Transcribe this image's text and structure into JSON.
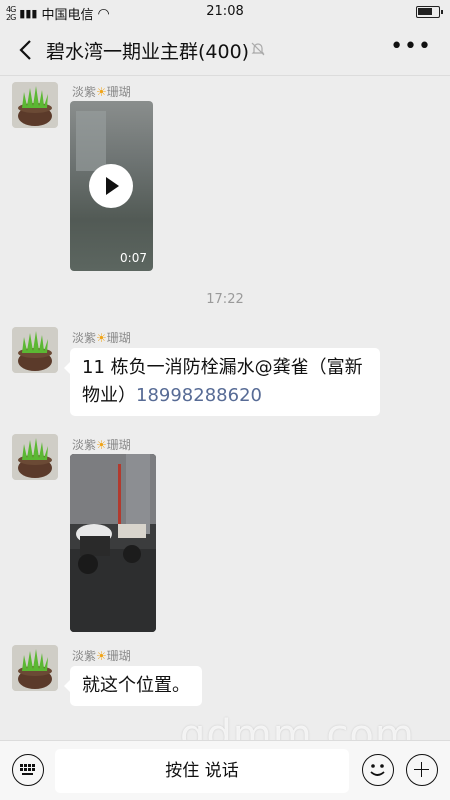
{
  "status_bar": {
    "network": "4G",
    "carrier": "中国电信",
    "time": "21:08"
  },
  "header": {
    "title": "碧水湾一期业主群(400)",
    "back_icon": "chevron-left-icon",
    "mute_icon": "bell-off-icon",
    "more_icon": "more-dots-icon"
  },
  "messages": [
    {
      "sender": "淡紫",
      "sender_suffix": "珊瑚",
      "type": "video",
      "duration": "0:07"
    },
    {
      "type": "timestamp",
      "text": "17:22"
    },
    {
      "sender": "淡紫",
      "sender_suffix": "珊瑚",
      "type": "text",
      "text": "11 栋负一消防栓漏水@龚雀（富新物业）",
      "phone": "18998288620"
    },
    {
      "sender": "淡紫",
      "sender_suffix": "珊瑚",
      "type": "image"
    },
    {
      "sender": "淡紫",
      "sender_suffix": "珊瑚",
      "type": "text",
      "text": "就这个位置。"
    }
  ],
  "input_bar": {
    "hold_to_talk": "按住 说话",
    "left_icon": "keyboard-icon",
    "emoji_icon": "emoji-icon",
    "plus_icon": "plus-icon"
  },
  "watermark": "gdmm.com",
  "colors": {
    "background": "#ededed",
    "bubble": "#ffffff",
    "link": "#576b95",
    "sun": "#f0a418"
  }
}
